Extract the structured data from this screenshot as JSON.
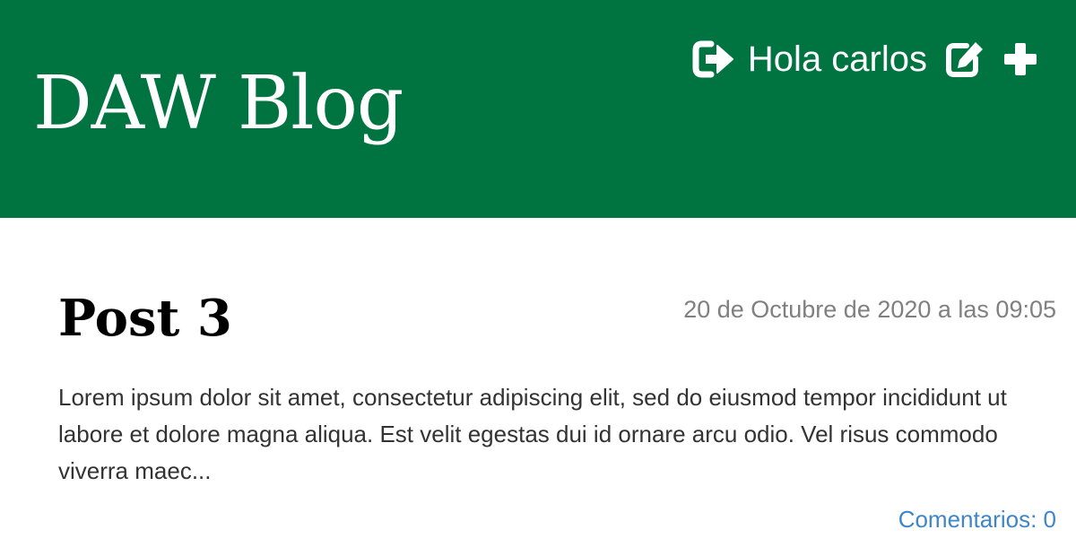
{
  "header": {
    "brand": "DAW Blog",
    "greeting": "Hola carlos",
    "icons": {
      "logout": "logout-icon",
      "edit": "edit-icon",
      "add": "plus-icon"
    },
    "background_color": "#007440"
  },
  "post": {
    "title": "Post 3",
    "date": "20 de Octubre de 2020 a las 09:05",
    "excerpt": "Lorem ipsum dolor sit amet, consectetur adipiscing elit, sed do eiusmod tempor incididunt ut labore et dolore magna aliqua. Est velit egestas dui id ornare arcu odio. Vel risus commodo viverra maec...",
    "comments_link": "Comentarios: 0",
    "link_color": "#3e86c8"
  }
}
